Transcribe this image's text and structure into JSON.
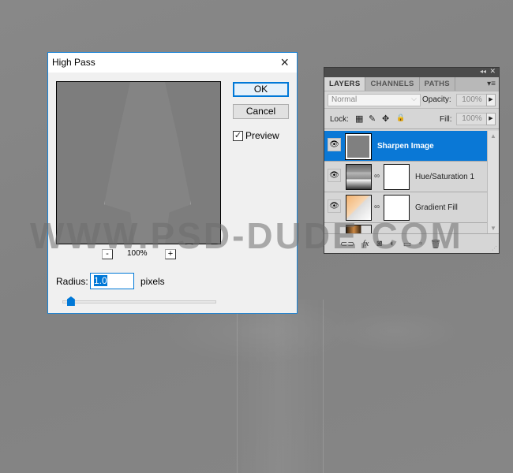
{
  "watermark": "WWW.PSD-DUDE.COM",
  "dialog": {
    "title": "High Pass",
    "close_icon": "×",
    "ok_label": "OK",
    "cancel_label": "Cancel",
    "preview_label": "Preview",
    "preview_checked": "✓",
    "zoom_out": "-",
    "zoom_in": "+",
    "zoom_level": "100%",
    "radius_label": "Radius:",
    "radius_value": "1.0",
    "radius_unit": "pixels",
    "radius_slider_fraction": 0.02
  },
  "layers_panel": {
    "collapse_icon": "◂◂",
    "close_icon": "✕",
    "menu_icon": "▾≡",
    "tabs": [
      {
        "label": "LAYERS",
        "active": true
      },
      {
        "label": "CHANNELS",
        "active": false
      },
      {
        "label": "PATHS",
        "active": false
      }
    ],
    "blend_mode": "Normal",
    "blend_chevron": "⌵",
    "opacity_label": "Opacity:",
    "opacity_value": "100%",
    "lock_label": "Lock:",
    "lock_icons": [
      "▦",
      "✎",
      "✥",
      "🔒"
    ],
    "fill_label": "Fill:",
    "fill_value": "100%",
    "arrow": "▶",
    "layers": [
      {
        "name": "Sharpen Image",
        "selected": true,
        "visible": true
      },
      {
        "name": "Hue/Saturation 1",
        "selected": false,
        "visible": true
      },
      {
        "name": "Gradient Fill",
        "selected": false,
        "visible": true
      }
    ],
    "eye_icon": "👁",
    "chain_icon": "∞",
    "scroll_up": "▲",
    "scroll_down": "▼",
    "footer_icons": [
      "⊂⊃",
      "fx",
      "◙",
      "◐",
      "▭",
      "▫",
      "🗑"
    ],
    "grip": "⋰"
  }
}
